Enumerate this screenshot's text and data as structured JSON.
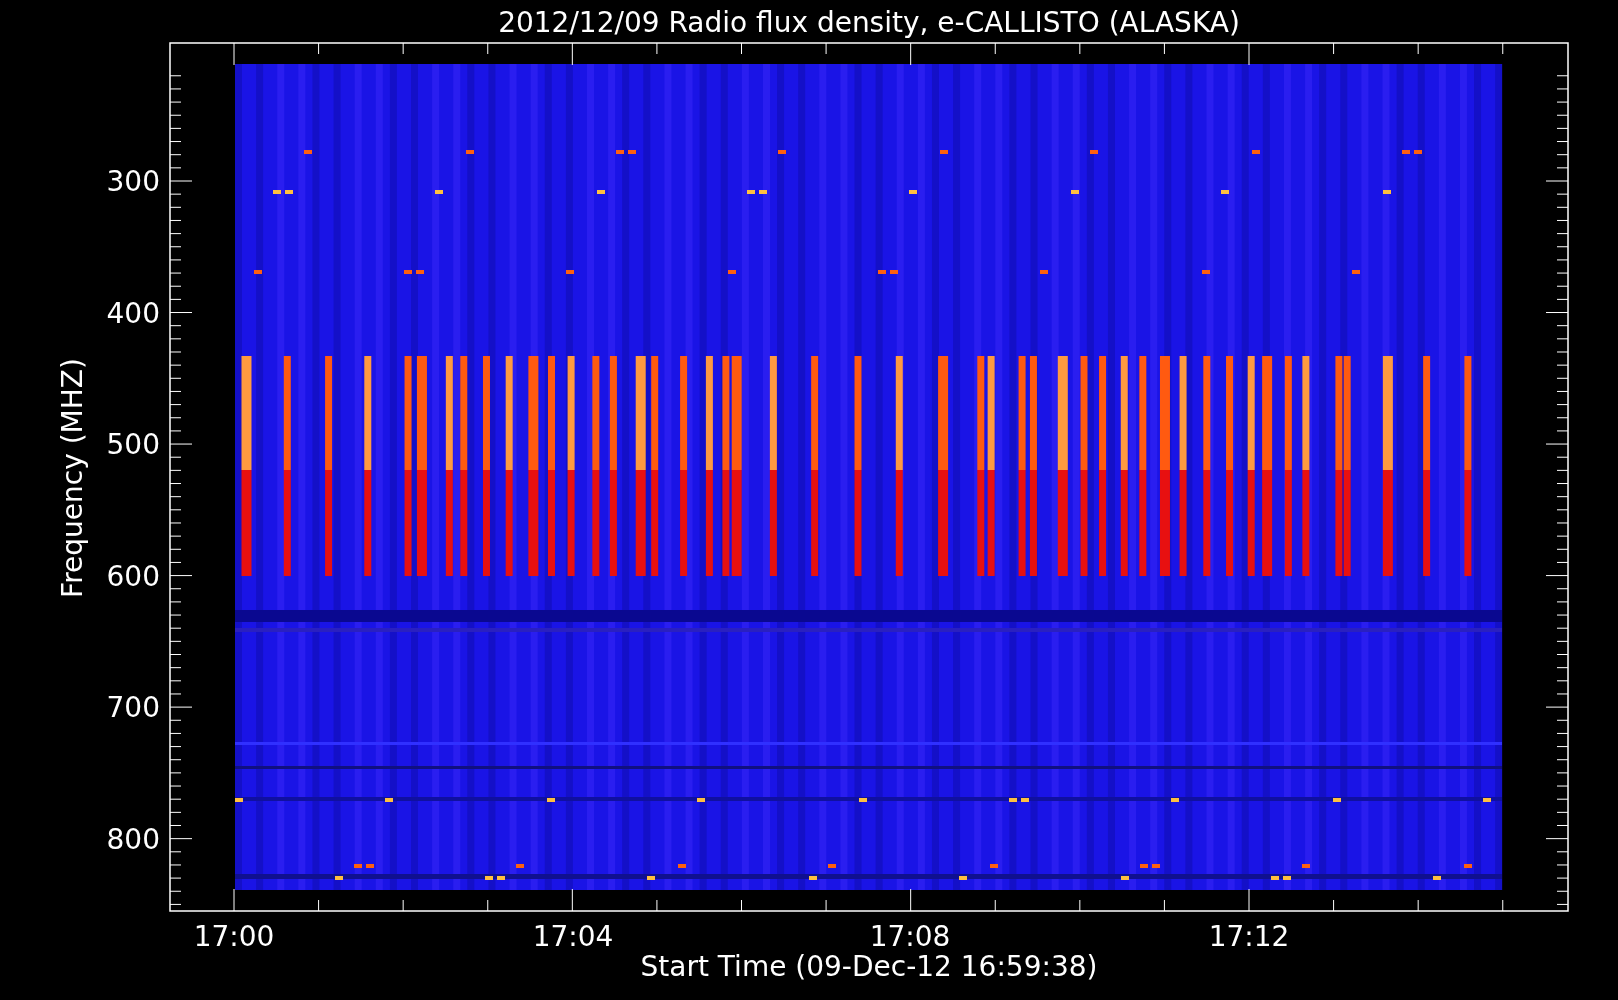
{
  "chart": {
    "title": "2012/12/09  Radio flux density, e-CALLISTO (ALASKA)",
    "ylabel": "Frequency (MHZ)",
    "yticks": [
      "300",
      "400",
      "500",
      "600",
      "700",
      "800"
    ],
    "xticks": [
      "17:00",
      "17:04",
      "17:08",
      "17:12"
    ],
    "xlabel": "Start Time (09-Dec-12 16:59:38)"
  }
}
